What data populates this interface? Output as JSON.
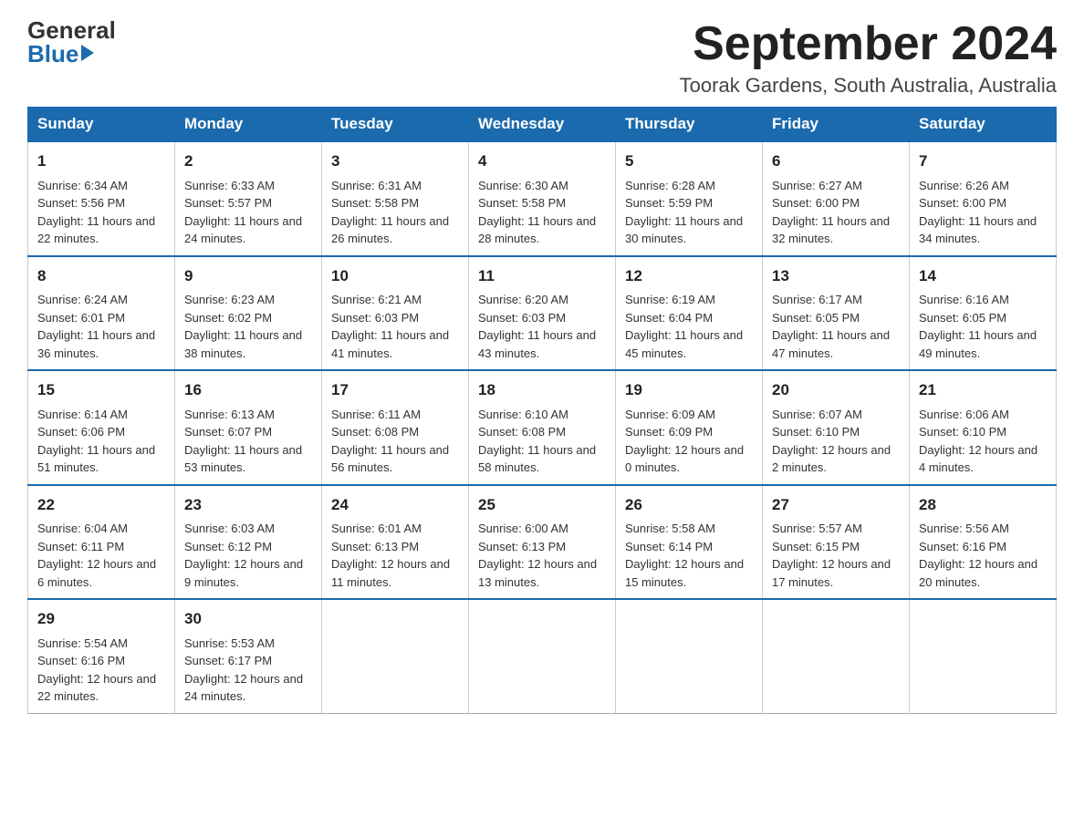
{
  "logo": {
    "general": "General",
    "blue": "Blue"
  },
  "header": {
    "month_year": "September 2024",
    "location": "Toorak Gardens, South Australia, Australia"
  },
  "days": {
    "headers": [
      "Sunday",
      "Monday",
      "Tuesday",
      "Wednesday",
      "Thursday",
      "Friday",
      "Saturday"
    ]
  },
  "weeks": [
    [
      {
        "num": "1",
        "sunrise": "Sunrise: 6:34 AM",
        "sunset": "Sunset: 5:56 PM",
        "daylight": "Daylight: 11 hours and 22 minutes."
      },
      {
        "num": "2",
        "sunrise": "Sunrise: 6:33 AM",
        "sunset": "Sunset: 5:57 PM",
        "daylight": "Daylight: 11 hours and 24 minutes."
      },
      {
        "num": "3",
        "sunrise": "Sunrise: 6:31 AM",
        "sunset": "Sunset: 5:58 PM",
        "daylight": "Daylight: 11 hours and 26 minutes."
      },
      {
        "num": "4",
        "sunrise": "Sunrise: 6:30 AM",
        "sunset": "Sunset: 5:58 PM",
        "daylight": "Daylight: 11 hours and 28 minutes."
      },
      {
        "num": "5",
        "sunrise": "Sunrise: 6:28 AM",
        "sunset": "Sunset: 5:59 PM",
        "daylight": "Daylight: 11 hours and 30 minutes."
      },
      {
        "num": "6",
        "sunrise": "Sunrise: 6:27 AM",
        "sunset": "Sunset: 6:00 PM",
        "daylight": "Daylight: 11 hours and 32 minutes."
      },
      {
        "num": "7",
        "sunrise": "Sunrise: 6:26 AM",
        "sunset": "Sunset: 6:00 PM",
        "daylight": "Daylight: 11 hours and 34 minutes."
      }
    ],
    [
      {
        "num": "8",
        "sunrise": "Sunrise: 6:24 AM",
        "sunset": "Sunset: 6:01 PM",
        "daylight": "Daylight: 11 hours and 36 minutes."
      },
      {
        "num": "9",
        "sunrise": "Sunrise: 6:23 AM",
        "sunset": "Sunset: 6:02 PM",
        "daylight": "Daylight: 11 hours and 38 minutes."
      },
      {
        "num": "10",
        "sunrise": "Sunrise: 6:21 AM",
        "sunset": "Sunset: 6:03 PM",
        "daylight": "Daylight: 11 hours and 41 minutes."
      },
      {
        "num": "11",
        "sunrise": "Sunrise: 6:20 AM",
        "sunset": "Sunset: 6:03 PM",
        "daylight": "Daylight: 11 hours and 43 minutes."
      },
      {
        "num": "12",
        "sunrise": "Sunrise: 6:19 AM",
        "sunset": "Sunset: 6:04 PM",
        "daylight": "Daylight: 11 hours and 45 minutes."
      },
      {
        "num": "13",
        "sunrise": "Sunrise: 6:17 AM",
        "sunset": "Sunset: 6:05 PM",
        "daylight": "Daylight: 11 hours and 47 minutes."
      },
      {
        "num": "14",
        "sunrise": "Sunrise: 6:16 AM",
        "sunset": "Sunset: 6:05 PM",
        "daylight": "Daylight: 11 hours and 49 minutes."
      }
    ],
    [
      {
        "num": "15",
        "sunrise": "Sunrise: 6:14 AM",
        "sunset": "Sunset: 6:06 PM",
        "daylight": "Daylight: 11 hours and 51 minutes."
      },
      {
        "num": "16",
        "sunrise": "Sunrise: 6:13 AM",
        "sunset": "Sunset: 6:07 PM",
        "daylight": "Daylight: 11 hours and 53 minutes."
      },
      {
        "num": "17",
        "sunrise": "Sunrise: 6:11 AM",
        "sunset": "Sunset: 6:08 PM",
        "daylight": "Daylight: 11 hours and 56 minutes."
      },
      {
        "num": "18",
        "sunrise": "Sunrise: 6:10 AM",
        "sunset": "Sunset: 6:08 PM",
        "daylight": "Daylight: 11 hours and 58 minutes."
      },
      {
        "num": "19",
        "sunrise": "Sunrise: 6:09 AM",
        "sunset": "Sunset: 6:09 PM",
        "daylight": "Daylight: 12 hours and 0 minutes."
      },
      {
        "num": "20",
        "sunrise": "Sunrise: 6:07 AM",
        "sunset": "Sunset: 6:10 PM",
        "daylight": "Daylight: 12 hours and 2 minutes."
      },
      {
        "num": "21",
        "sunrise": "Sunrise: 6:06 AM",
        "sunset": "Sunset: 6:10 PM",
        "daylight": "Daylight: 12 hours and 4 minutes."
      }
    ],
    [
      {
        "num": "22",
        "sunrise": "Sunrise: 6:04 AM",
        "sunset": "Sunset: 6:11 PM",
        "daylight": "Daylight: 12 hours and 6 minutes."
      },
      {
        "num": "23",
        "sunrise": "Sunrise: 6:03 AM",
        "sunset": "Sunset: 6:12 PM",
        "daylight": "Daylight: 12 hours and 9 minutes."
      },
      {
        "num": "24",
        "sunrise": "Sunrise: 6:01 AM",
        "sunset": "Sunset: 6:13 PM",
        "daylight": "Daylight: 12 hours and 11 minutes."
      },
      {
        "num": "25",
        "sunrise": "Sunrise: 6:00 AM",
        "sunset": "Sunset: 6:13 PM",
        "daylight": "Daylight: 12 hours and 13 minutes."
      },
      {
        "num": "26",
        "sunrise": "Sunrise: 5:58 AM",
        "sunset": "Sunset: 6:14 PM",
        "daylight": "Daylight: 12 hours and 15 minutes."
      },
      {
        "num": "27",
        "sunrise": "Sunrise: 5:57 AM",
        "sunset": "Sunset: 6:15 PM",
        "daylight": "Daylight: 12 hours and 17 minutes."
      },
      {
        "num": "28",
        "sunrise": "Sunrise: 5:56 AM",
        "sunset": "Sunset: 6:16 PM",
        "daylight": "Daylight: 12 hours and 20 minutes."
      }
    ],
    [
      {
        "num": "29",
        "sunrise": "Sunrise: 5:54 AM",
        "sunset": "Sunset: 6:16 PM",
        "daylight": "Daylight: 12 hours and 22 minutes."
      },
      {
        "num": "30",
        "sunrise": "Sunrise: 5:53 AM",
        "sunset": "Sunset: 6:17 PM",
        "daylight": "Daylight: 12 hours and 24 minutes."
      },
      null,
      null,
      null,
      null,
      null
    ]
  ]
}
